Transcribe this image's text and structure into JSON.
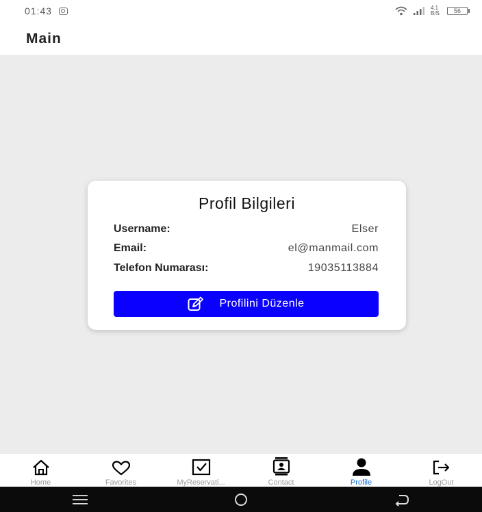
{
  "status_bar": {
    "time": "01:43",
    "network_text": "4.1 B/S",
    "battery": "56"
  },
  "app_bar": {
    "title": "Main"
  },
  "profile_card": {
    "title": "Profil Bilgileri",
    "username_label": "Username:",
    "username_value": "Elser",
    "email_label": "Email:",
    "email_value": "el@manmail.com",
    "phone_label": "Telefon Numarası:",
    "phone_value": "19035113884",
    "edit_button_label": "Profilini Düzenle",
    "edit_button_icon": "edit-icon",
    "button_color": "#0a00ff"
  },
  "bottom_nav": {
    "active_color": "#1a6fd6",
    "items": [
      {
        "label": "Home",
        "icon": "home-icon"
      },
      {
        "label": "Favorites",
        "icon": "heart-icon"
      },
      {
        "label": "MyReservati...",
        "icon": "checkbox-icon"
      },
      {
        "label": "Contact",
        "icon": "contact-icon"
      },
      {
        "label": "Profile",
        "icon": "person-icon",
        "active": true
      },
      {
        "label": "LogOut",
        "icon": "logout-icon"
      }
    ]
  },
  "system_nav": [
    "menu-icon",
    "home-circle-icon",
    "back-icon"
  ]
}
